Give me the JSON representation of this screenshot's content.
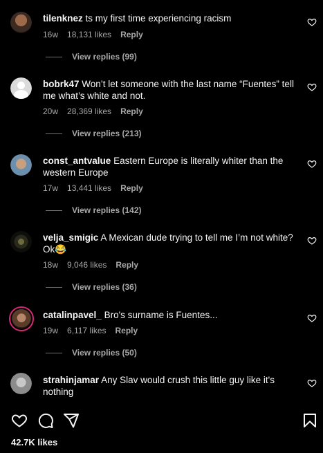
{
  "comments": [
    {
      "username": "tilenknez",
      "text": "ts my first time experiencing racism",
      "age": "16w",
      "likes": "18,131 likes",
      "reply": "Reply",
      "view_replies": "View replies (99)"
    },
    {
      "username": "bobrk47",
      "text": "Won’t let someone with the last name “Fuentes” tell me what’s white and not.",
      "age": "20w",
      "likes": "28,369 likes",
      "reply": "Reply",
      "view_replies": "View replies (213)"
    },
    {
      "username": "const_antvalue",
      "text": "Eastern Europe is literally whiter than the western Europe",
      "age": "17w",
      "likes": "13,441 likes",
      "reply": "Reply",
      "view_replies": "View replies (142)"
    },
    {
      "username": "velja_smigic",
      "text": "A Mexican dude trying to tell me I’m not white? Ok😂",
      "age": "18w",
      "likes": "9,046 likes",
      "reply": "Reply",
      "view_replies": "View replies (36)"
    },
    {
      "username": "catalinpavel_",
      "text": "Bro's surname is Fuentes...",
      "age": "19w",
      "likes": "6,117 likes",
      "reply": "Reply",
      "view_replies": "View replies (50)"
    },
    {
      "username": "strahinjamar",
      "text": "Any Slav would crush this little guy like it's nothing"
    }
  ],
  "post": {
    "likes": "42.7K likes"
  },
  "icons": {
    "like": "heart-icon",
    "comment": "comment-bubble-icon",
    "share": "paper-plane-icon",
    "save": "bookmark-icon",
    "comment_like": "heart-outline-icon"
  },
  "colors": {
    "background": "#000000",
    "text": "#f5f5f5",
    "secondary": "#a8a8a8",
    "story_ring": "#d62976"
  }
}
